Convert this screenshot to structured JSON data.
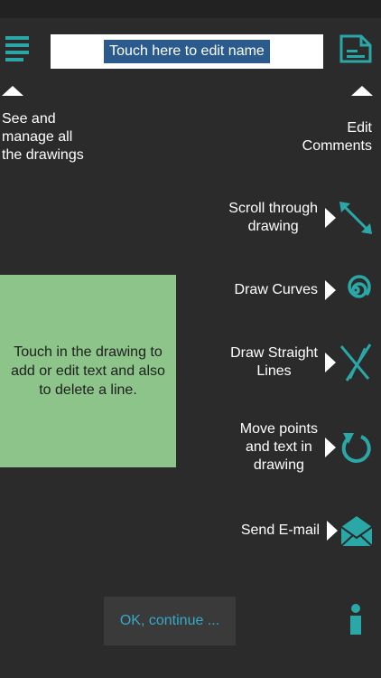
{
  "header": {
    "name_field_text": "Touch here to edit name"
  },
  "hints": {
    "manage_drawings": [
      "See and",
      "manage all",
      "the drawings"
    ],
    "edit_comments": [
      "Edit",
      "Comments"
    ]
  },
  "tools": [
    {
      "label": [
        "Scroll through",
        "drawing"
      ],
      "icon": "scroll-arrows-icon"
    },
    {
      "label": [
        "Draw Curves"
      ],
      "icon": "spiral-curve-icon"
    },
    {
      "label": [
        "Draw Straight",
        "Lines"
      ],
      "icon": "crossed-lines-icon"
    },
    {
      "label": [
        "Move points",
        "and text in",
        "drawing"
      ],
      "icon": "rotate-arrow-icon"
    },
    {
      "label": [
        "Send E-mail"
      ],
      "icon": "envelope-icon"
    }
  ],
  "drawing_area": {
    "text": [
      "Touch in the drawing to",
      "add or edit text and also",
      "to delete a line."
    ]
  },
  "buttons": {
    "ok_label": "OK, continue ..."
  },
  "colors": {
    "background": "#2b2b2b",
    "accent": "#2aa7a7",
    "drawing_area": "#8cc48a",
    "ok_text": "#36a9c9"
  }
}
